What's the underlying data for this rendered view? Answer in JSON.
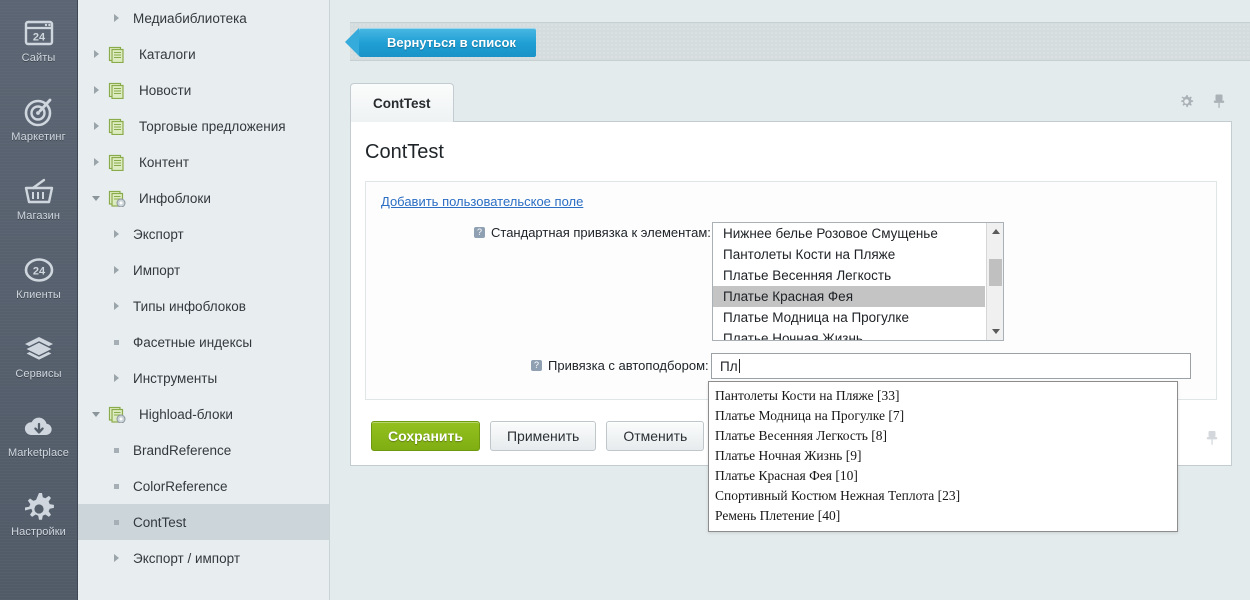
{
  "rail": {
    "items": [
      {
        "label": "Сайты",
        "icon": "sites-24-icon"
      },
      {
        "label": "Маркетинг",
        "icon": "marketing-target-icon"
      },
      {
        "label": "Магазин",
        "icon": "shop-basket-icon"
      },
      {
        "label": "Клиенты",
        "icon": "clients-24-icon"
      },
      {
        "label": "Сервисы",
        "icon": "services-layers-icon"
      },
      {
        "label": "Marketplace",
        "icon": "marketplace-cloud-icon"
      },
      {
        "label": "Настройки",
        "icon": "settings-gear-icon"
      }
    ]
  },
  "tree": {
    "items": [
      {
        "label": "Медиабиблиотека",
        "marker": "arrow",
        "indent": 2,
        "icon": "none",
        "selected": false
      },
      {
        "label": "Каталоги",
        "marker": "arrow",
        "indent": 1,
        "icon": "infoblock",
        "selected": false
      },
      {
        "label": "Новости",
        "marker": "arrow",
        "indent": 1,
        "icon": "infoblock",
        "selected": false
      },
      {
        "label": "Торговые предложения",
        "marker": "arrow",
        "indent": 1,
        "icon": "infoblock",
        "selected": false
      },
      {
        "label": "Контент",
        "marker": "arrow",
        "indent": 1,
        "icon": "infoblock",
        "selected": false
      },
      {
        "label": "Инфоблоки",
        "marker": "arrow-open",
        "indent": 1,
        "icon": "infoblock-gear",
        "selected": false
      },
      {
        "label": "Экспорт",
        "marker": "arrow",
        "indent": 2,
        "icon": "none",
        "selected": false
      },
      {
        "label": "Импорт",
        "marker": "arrow",
        "indent": 2,
        "icon": "none",
        "selected": false
      },
      {
        "label": "Типы инфоблоков",
        "marker": "arrow",
        "indent": 2,
        "icon": "none",
        "selected": false
      },
      {
        "label": "Фасетные индексы",
        "marker": "bullet",
        "indent": 2,
        "icon": "none",
        "selected": false
      },
      {
        "label": "Инструменты",
        "marker": "arrow",
        "indent": 2,
        "icon": "none",
        "selected": false
      },
      {
        "label": "Highload-блоки",
        "marker": "arrow-open",
        "indent": 1,
        "icon": "infoblock-gear",
        "selected": false
      },
      {
        "label": "BrandReference",
        "marker": "bullet",
        "indent": 2,
        "icon": "none",
        "selected": false
      },
      {
        "label": "ColorReference",
        "marker": "bullet",
        "indent": 2,
        "icon": "none",
        "selected": false
      },
      {
        "label": "ContTest",
        "marker": "bullet",
        "indent": 2,
        "icon": "none",
        "selected": true
      },
      {
        "label": "Экспорт / импорт",
        "marker": "arrow",
        "indent": 2,
        "icon": "none",
        "selected": false
      }
    ]
  },
  "toolbar": {
    "back_label": "Вернуться в список"
  },
  "tabs": {
    "items": [
      {
        "label": "ContTest",
        "active": true
      }
    ],
    "tools": [
      {
        "name": "gear-icon"
      },
      {
        "name": "pin-icon"
      }
    ]
  },
  "page": {
    "title": "ContTest",
    "add_field_link": "Добавить пользовательское поле"
  },
  "fields": {
    "standard_binding": {
      "label": "Стандартная привязка к элементам:",
      "help": "?",
      "options": [
        {
          "text": "Нижнее белье Розовое Смущенье",
          "selected": false
        },
        {
          "text": "Пантолеты Кости на Пляже",
          "selected": false
        },
        {
          "text": "Платье Весенняя Легкость",
          "selected": false
        },
        {
          "text": "Платье Красная Фея",
          "selected": true
        },
        {
          "text": "Платье Модница на Прогулке",
          "selected": false
        },
        {
          "text": "Платье Ночная Жизнь",
          "selected": false
        }
      ]
    },
    "autocomplete_binding": {
      "label": "Привязка с автоподбором:",
      "help": "?",
      "value": "Пл",
      "placeholder": "",
      "suggestions": [
        "Пантолеты Кости на Пляже [33]",
        "Платье Модница на Прогулке [7]",
        "Платье Весенняя Легкость [8]",
        "Платье Ночная Жизнь [9]",
        "Платье Красная Фея [10]",
        "Спортивный Костюм Нежная Теплота [23]",
        "Ремень Плетение [40]"
      ]
    }
  },
  "buttons": {
    "save": "Сохранить",
    "apply": "Применить",
    "cancel": "Отменить"
  },
  "colors": {
    "accent_blue": "#1f9fd4",
    "accent_green": "#94c11f",
    "link": "#2b6ec4",
    "rail_bg": "#545e6b",
    "page_bg": "#e4ebed",
    "selection": "#c4c4c4"
  }
}
